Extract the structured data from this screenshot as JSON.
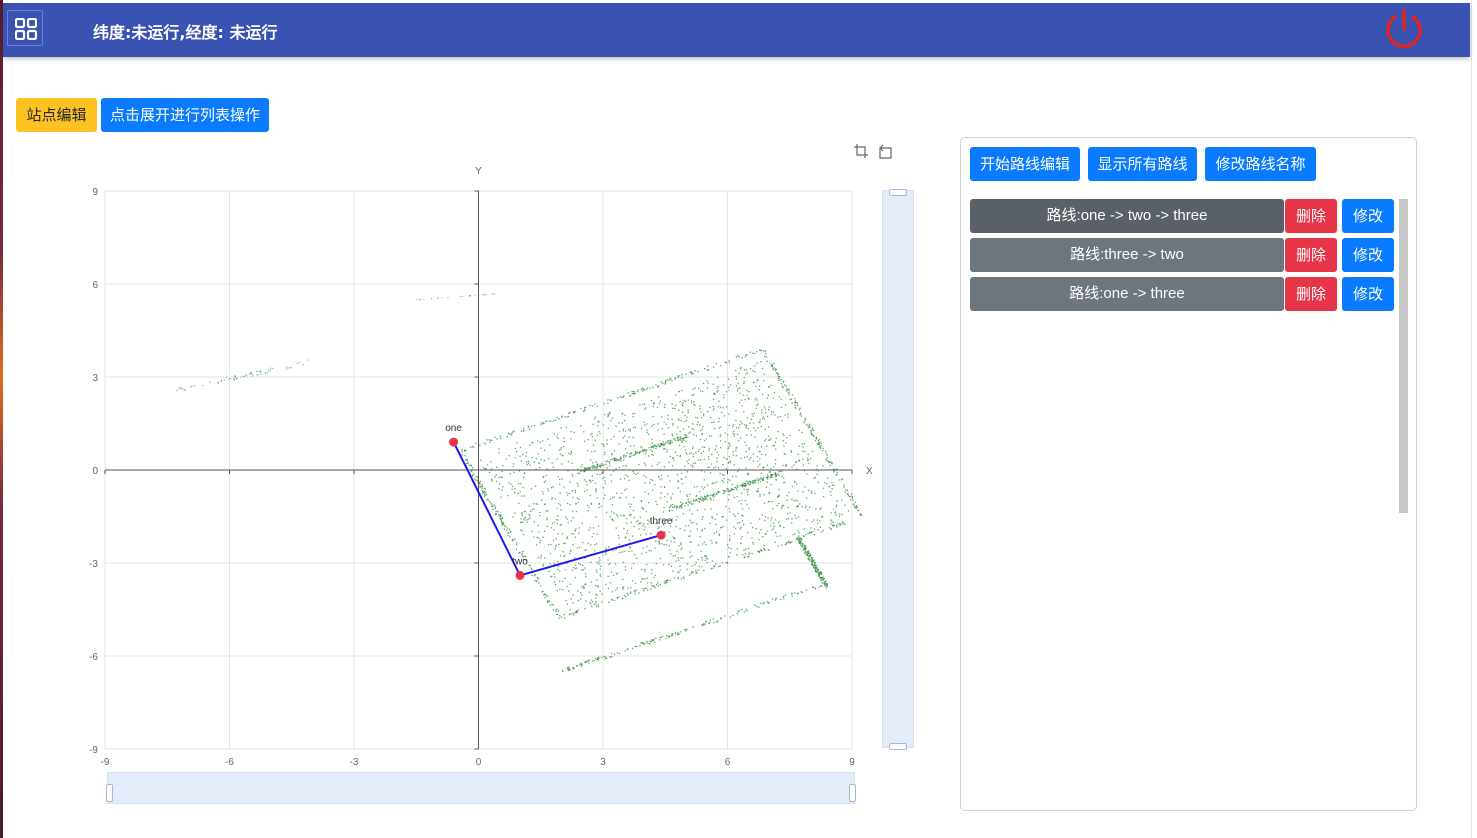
{
  "header": {
    "coords_text": "纬度:未运行,经度: 未运行",
    "menu_icon": "grid-icon",
    "power_icon": "power-icon",
    "background": "#3a52b2",
    "power_color": "#e02424"
  },
  "toolbar": {
    "station_edit": "站点编辑",
    "expand_list": "点击展开进行列表操作"
  },
  "route_panel": {
    "start_edit": "开始路线编辑",
    "show_all": "显示所有路线",
    "rename": "修改路线名称",
    "routes": [
      {
        "label": "路线:one -> two -> three",
        "delete": "删除",
        "modify": "修改"
      },
      {
        "label": "路线:three -> two",
        "delete": "删除",
        "modify": "修改"
      },
      {
        "label": "路线:one -> three",
        "delete": "删除",
        "modify": "修改"
      }
    ]
  },
  "chart_data": {
    "type": "scatter",
    "xlabel": "X",
    "ylabel": "Y",
    "xlim": [
      -9,
      9
    ],
    "ylim": [
      -9,
      9
    ],
    "xticks": [
      -9,
      -6,
      -3,
      0,
      3,
      6,
      9
    ],
    "yticks": [
      -9,
      -6,
      -3,
      0,
      3,
      6,
      9
    ],
    "grid": true,
    "stations": [
      {
        "name": "one",
        "x": -0.6,
        "y": 0.9
      },
      {
        "name": "two",
        "x": 1.0,
        "y": -3.4
      },
      {
        "name": "three",
        "x": 4.4,
        "y": -2.1
      }
    ],
    "route_path": [
      "one",
      "two",
      "three"
    ],
    "colors": {
      "route": "#1a1aee",
      "station": "#e8344a",
      "map_points": "#2e8b3a"
    },
    "toolbox_icons": [
      "zoom-select-icon",
      "zoom-reset-icon"
    ]
  }
}
